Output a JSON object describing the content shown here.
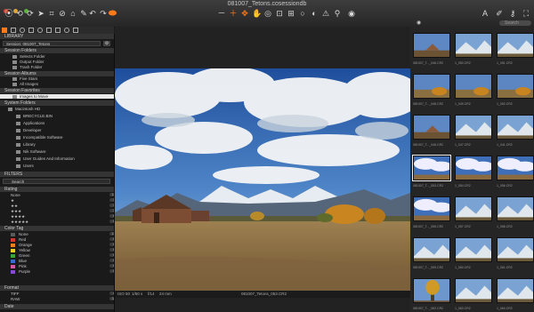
{
  "window": {
    "title": "081007_Tetons.cosessiondb"
  },
  "toolbar": {
    "left_icons": [
      "camera-icon",
      "rotate-left-icon",
      "rotate-right-icon",
      "cursor-icon",
      "crop-icon",
      "straighten-icon",
      "keystone-icon",
      "brush-icon",
      "undo-icon",
      "redo-icon",
      "reset-icon",
      "capture-icon"
    ],
    "center_icons": [
      "zoom-out-icon",
      "zoom-in-icon",
      "multi-view-icon",
      "pan-icon",
      "loupe-icon",
      "sel-icon",
      "grid-icon",
      "overlay-icon",
      "focus-mask-icon",
      "exposure-warning-icon",
      "color-picker-icon",
      "white-balance-icon"
    ],
    "right_icons": [
      "text-icon",
      "edit-icon",
      "eye-dropper-icon",
      "crop-tool-icon"
    ],
    "search_placeholder": "Search"
  },
  "left_panel": {
    "library_header": "LIBRARY",
    "session_title": "Session: 081007_Tetons",
    "sections": {
      "session_folders": "Session Folders",
      "session_albums": "Session Albums",
      "session_favorites": "Session Favorites",
      "system_folders": "System Folders",
      "filters": "FILTERS",
      "rating": "Rating",
      "color_tag": "Color Tag",
      "format": "Format",
      "date": "Date"
    },
    "session_folder_items": [
      "Selects Folder",
      "Output Folder",
      "Trash Folder"
    ],
    "album_items": [
      "Five Stars",
      "All Images"
    ],
    "favorite_items": [
      "Images to Move"
    ],
    "system_folder_items": [
      "Macintosh HD",
      "BRECYCLE.BIN",
      "Applications",
      "Developer",
      "Incompatible Software",
      "Library",
      "Nik Software",
      "User Guides And Information",
      "Users"
    ],
    "filter_search_placeholder": "Search",
    "rating_items": [
      {
        "label": "None",
        "count": "13"
      },
      {
        "label": "★",
        "count": "1"
      },
      {
        "label": "★★",
        "count": "1"
      },
      {
        "label": "★★★",
        "count": "3"
      },
      {
        "label": "★★★★",
        "count": "0"
      },
      {
        "label": "★★★★★",
        "count": "0"
      }
    ],
    "color_items": [
      {
        "label": "None",
        "color": "#5a5a5a",
        "count": "15"
      },
      {
        "label": "Red",
        "color": "#d03a2a",
        "count": "0"
      },
      {
        "label": "Orange",
        "color": "#e8821e",
        "count": "0"
      },
      {
        "label": "Yellow",
        "color": "#e8d22a",
        "count": "0"
      },
      {
        "label": "Green",
        "color": "#3aa63a",
        "count": "0"
      },
      {
        "label": "Blue",
        "color": "#3a6ad0",
        "count": "0"
      },
      {
        "label": "Pink",
        "color": "#d05aa8",
        "count": "0"
      },
      {
        "label": "Purple",
        "color": "#8a4ad0",
        "count": "0"
      }
    ],
    "format_items": [
      {
        "label": "TIFF",
        "count": "4"
      },
      {
        "label": "RAW",
        "count": "11"
      }
    ]
  },
  "viewer": {
    "info": {
      "iso": "ISO 50",
      "shutter": "1/50 s",
      "aperture": "f/14",
      "focal": "24 mm",
      "filename": "081007_Tetons_053.CR2"
    }
  },
  "browser": {
    "thumbs": [
      {
        "label": "081007_T..._046.CR2",
        "scene": "barn"
      },
      {
        "label": "1_050.CR2",
        "scene": "mountain"
      },
      {
        "label": "1_051.CR2",
        "scene": "mountain"
      },
      {
        "label": "081007_T..._048.CR2",
        "scene": "autumn"
      },
      {
        "label": "1_049.CR2",
        "scene": "autumn"
      },
      {
        "label": "1_052.CR2",
        "scene": "autumn"
      },
      {
        "label": "081007_T..._046.CR2",
        "scene": "barn"
      },
      {
        "label": "1_047.CR2",
        "scene": "mountain"
      },
      {
        "label": "1_041.CR2",
        "scene": "mountain"
      },
      {
        "label": "081007_T..._053.CR2",
        "scene": "clouds",
        "active": true
      },
      {
        "label": "1_054.CR2",
        "scene": "clouds"
      },
      {
        "label": "1_056.CR2",
        "scene": "clouds"
      },
      {
        "label": "081007_T..._055.CR2",
        "scene": "clouds"
      },
      {
        "label": "1_057.CR2",
        "scene": "mountain"
      },
      {
        "label": "1_058.CR2",
        "scene": "mountain"
      },
      {
        "label": "081007_T..._059.CR2",
        "scene": "mountain"
      },
      {
        "label": "1_060.CR2",
        "scene": "mountain"
      },
      {
        "label": "1_061.CR2",
        "scene": "mountain"
      },
      {
        "label": "081007_T..._062.CR2",
        "scene": "tree"
      },
      {
        "label": "1_063.CR2",
        "scene": "mountain"
      },
      {
        "label": "1_064.CR2",
        "scene": "mountain"
      }
    ]
  }
}
